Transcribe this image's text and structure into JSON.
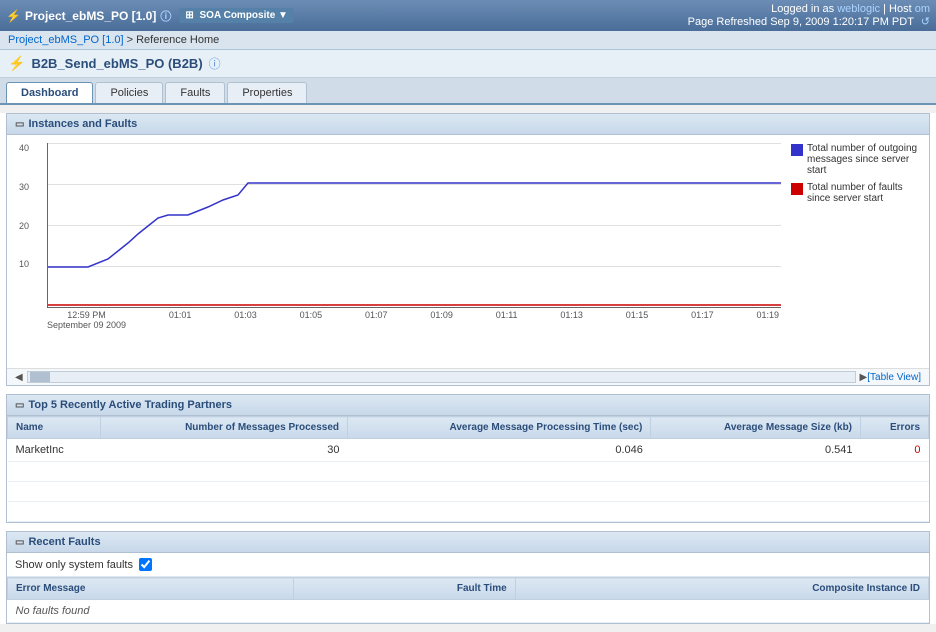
{
  "header": {
    "title": "Project_ebMS_PO [1.0]",
    "info_icon": "ⓘ",
    "soa_composite_label": "SOA Composite ▼",
    "logged_in_label": "Logged in as",
    "user": "weblogic",
    "separator": "|",
    "host_label": "Host",
    "user_link": "om",
    "refresh_label": "Page Refreshed Sep 9, 2009 1:20:17 PM PDT",
    "refresh_icon": "↺"
  },
  "breadcrumb": {
    "project_link": "Project_ebMS_PO [1.0]",
    "separator": " > ",
    "current": "Reference Home"
  },
  "page_title": {
    "icon": "⚡",
    "text": "B2B_Send_ebMS_PO (B2B)",
    "info_icon": "ⓘ"
  },
  "tabs": [
    {
      "id": "dashboard",
      "label": "Dashboard",
      "active": true
    },
    {
      "id": "policies",
      "label": "Policies",
      "active": false
    },
    {
      "id": "faults",
      "label": "Faults",
      "active": false
    },
    {
      "id": "properties",
      "label": "Properties",
      "active": false
    }
  ],
  "instances_faults": {
    "section_title": "Instances and Faults",
    "chart": {
      "y_labels": [
        "40",
        "30",
        "20",
        "10",
        ""
      ],
      "x_labels": [
        "12:59 PM\nSeptember 09 2009",
        "01:01",
        "01:03",
        "01:05",
        "01:07",
        "01:09",
        "01:11",
        "01:13",
        "01:15",
        "01:17",
        "01:19"
      ],
      "table_view_link": "[Table View]"
    },
    "legend": [
      {
        "color": "#3333cc",
        "text": "Total number of outgoing messages since server start"
      },
      {
        "color": "#cc0000",
        "text": "Total number of faults since server start"
      }
    ]
  },
  "trading_partners": {
    "section_title": "Top 5 Recently Active Trading Partners",
    "columns": [
      {
        "id": "name",
        "label": "Name",
        "align": "left"
      },
      {
        "id": "messages_processed",
        "label": "Number of Messages Processed",
        "align": "right"
      },
      {
        "id": "avg_processing_time",
        "label": "Average Message Processing Time (sec)",
        "align": "right"
      },
      {
        "id": "avg_message_size",
        "label": "Average Message Size (kb)",
        "align": "right"
      },
      {
        "id": "errors",
        "label": "Errors",
        "align": "right"
      }
    ],
    "rows": [
      {
        "name": "MarketInc",
        "messages_processed": "30",
        "avg_processing_time": "0.046",
        "avg_message_size": "0.541",
        "errors": "0"
      }
    ]
  },
  "recent_faults": {
    "section_title": "Recent Faults",
    "show_system_faults_label": "Show only system faults",
    "checkbox_checked": true,
    "columns": [
      {
        "id": "error_message",
        "label": "Error Message",
        "align": "left"
      },
      {
        "id": "fault_time",
        "label": "Fault Time",
        "align": "right"
      },
      {
        "id": "composite_instance_id",
        "label": "Composite Instance ID",
        "align": "right"
      }
    ],
    "no_faults_text": "No faults found"
  }
}
